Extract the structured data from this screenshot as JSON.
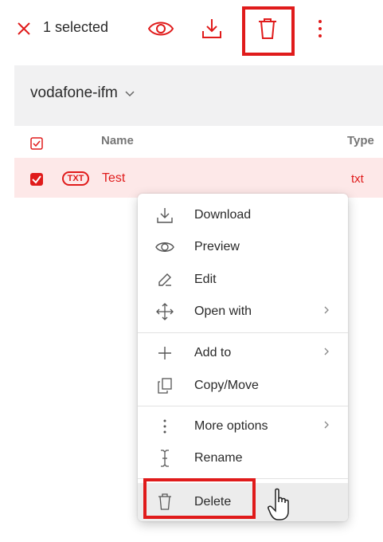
{
  "toolbar": {
    "selected_label": "1 selected",
    "icons": [
      "close-icon",
      "eye-icon",
      "download-icon",
      "trash-icon",
      "more-vertical-icon"
    ]
  },
  "breadcrumb": {
    "folder": "vodafone-ifm"
  },
  "table": {
    "columns": [
      "Name",
      "Type"
    ],
    "rows": [
      {
        "badge": "TXT",
        "name": "Test",
        "type": "txt",
        "selected": true
      }
    ]
  },
  "context_menu": {
    "items": [
      {
        "label": "Download",
        "icon": "download-icon"
      },
      {
        "label": "Preview",
        "icon": "eye-icon"
      },
      {
        "label": "Edit",
        "icon": "pencil-icon"
      },
      {
        "label": "Open with",
        "icon": "move-arrows-icon",
        "submenu": true
      },
      {
        "label": "Add to",
        "icon": "plus-icon",
        "submenu": true
      },
      {
        "label": "Copy/Move",
        "icon": "copy-icon"
      },
      {
        "label": "More options",
        "icon": "more-vertical-icon",
        "submenu": true
      },
      {
        "label": "Rename",
        "icon": "text-cursor-icon"
      },
      {
        "label": "Delete",
        "icon": "trash-icon",
        "hovered": true
      }
    ]
  },
  "colors": {
    "accent": "#e01b1b",
    "row_highlight": "#fde8e8",
    "background_grey": "#f1f1f2"
  }
}
